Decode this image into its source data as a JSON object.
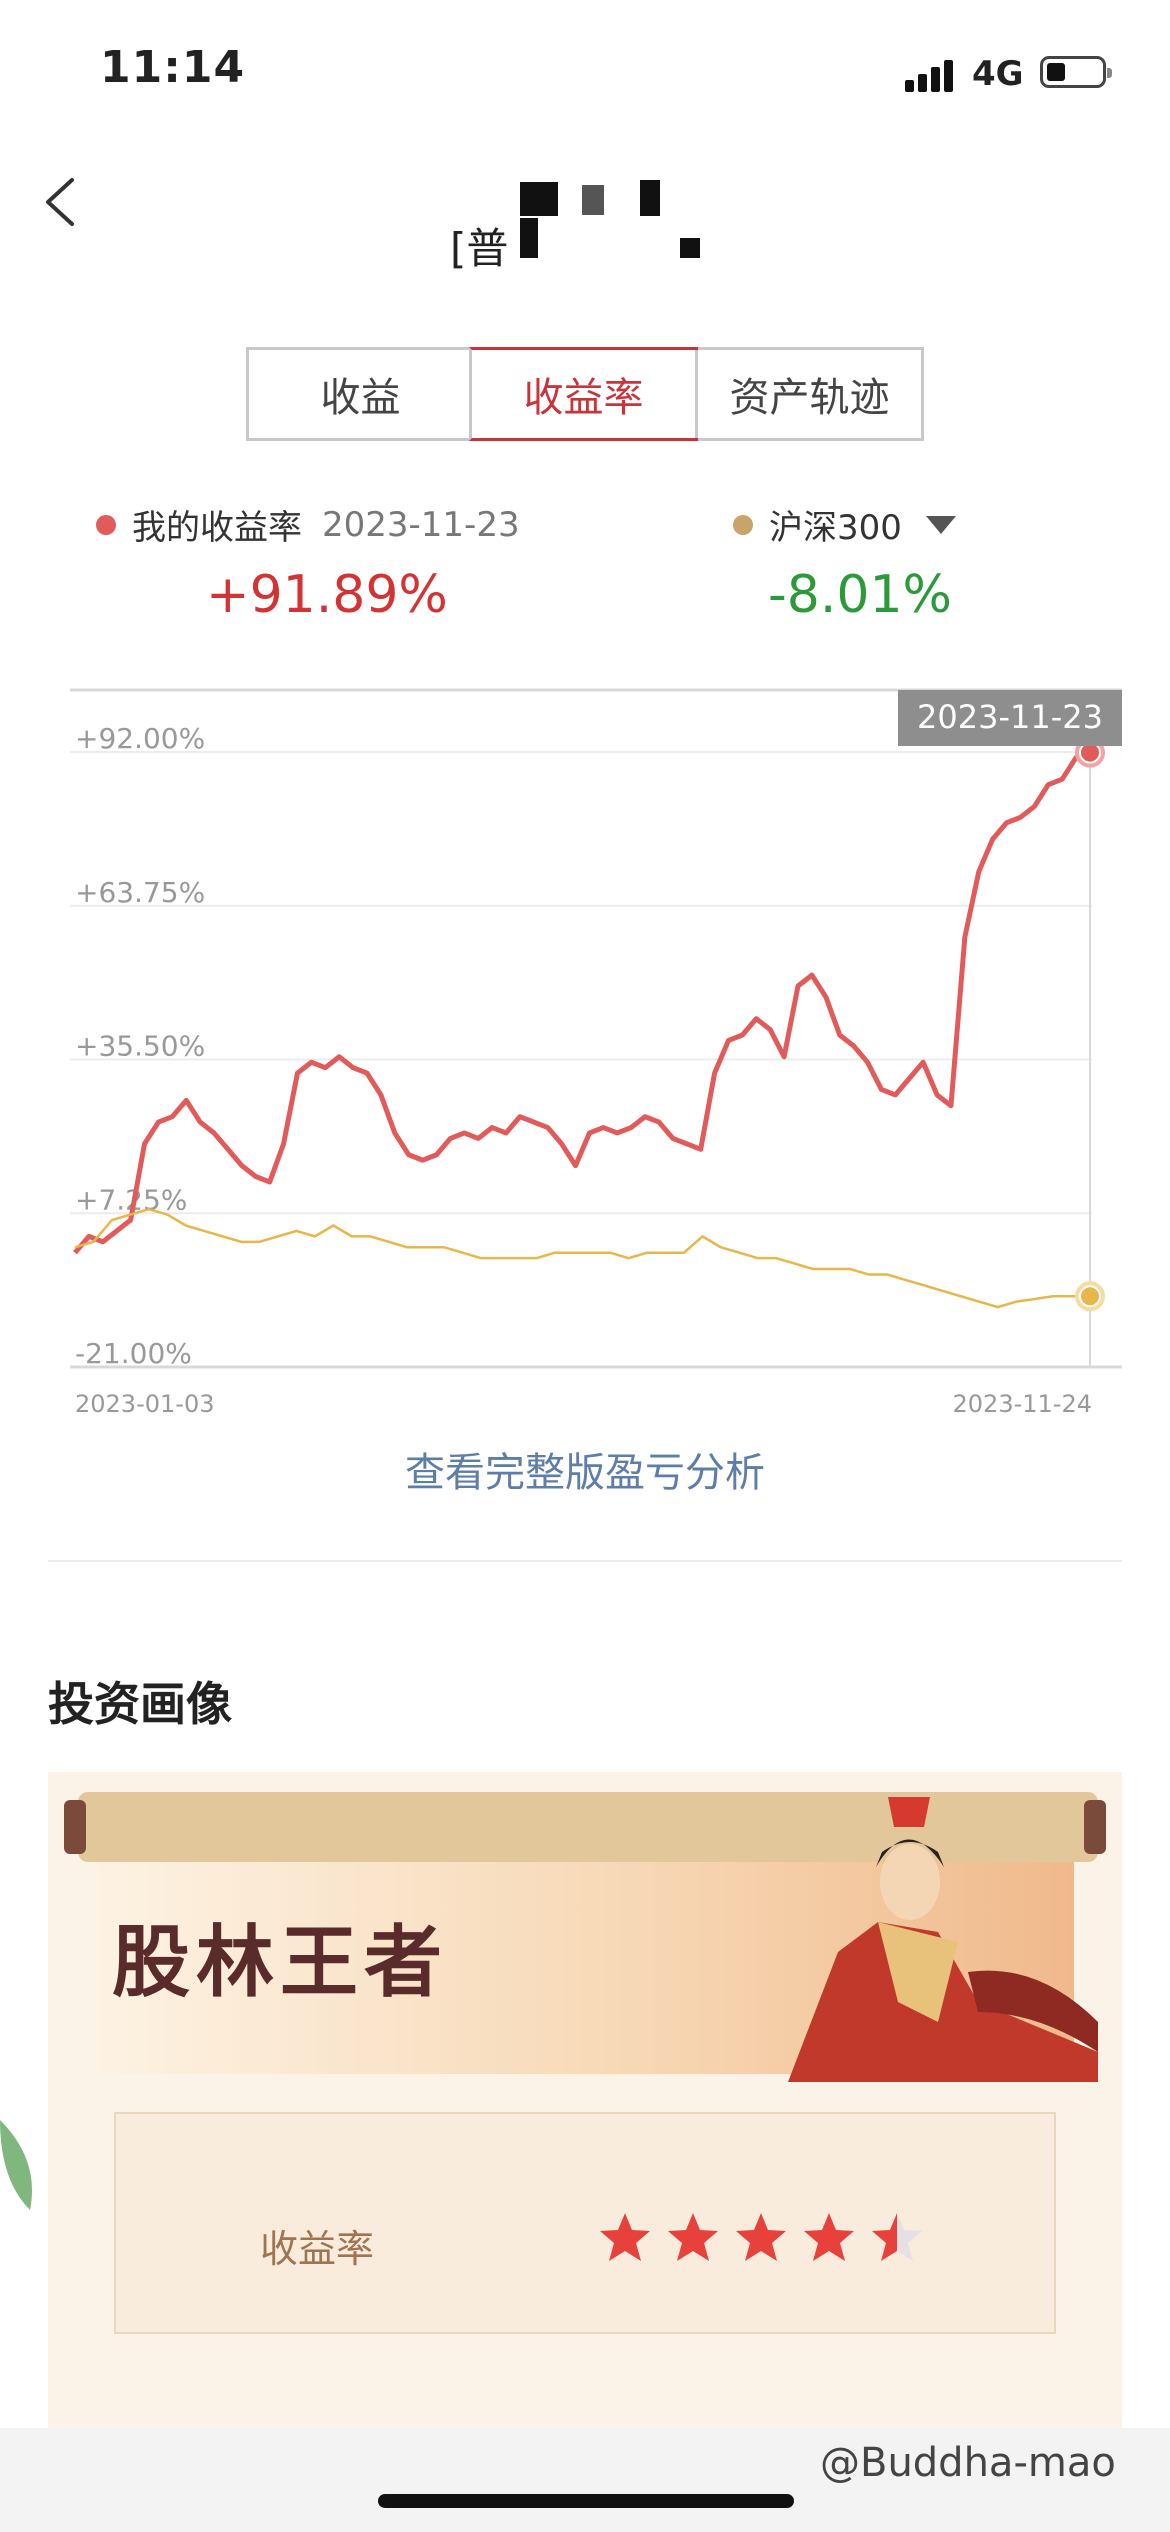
{
  "status_bar": {
    "time": "11:14",
    "network": "4G",
    "battery_level": 0.3
  },
  "header": {
    "title": "[普",
    "back_icon": "chevron-left-icon"
  },
  "tabs": [
    {
      "label": "收益",
      "active": false
    },
    {
      "label": "收益率",
      "active": true
    },
    {
      "label": "资产轨迹",
      "active": false
    }
  ],
  "legend": {
    "mine": {
      "label": "我的收益率",
      "date": "2023-11-23",
      "value": "+91.89%",
      "color": "#e25b5b"
    },
    "index": {
      "label": "沪深300",
      "value": "-8.01%",
      "color": "#c8a46a"
    }
  },
  "chart_data": {
    "type": "line",
    "y_tick_labels": [
      "+92.00%",
      "+63.75%",
      "+35.50%",
      "+7.25%",
      "-21.00%"
    ],
    "ylim": [
      -21.0,
      92.0
    ],
    "x_tick_labels": [
      "2023-01-03",
      "2023-11-24"
    ],
    "tooltip_date": "2023-11-23",
    "series": [
      {
        "name": "我的收益率",
        "color": "#e25b5b",
        "values": [
          0,
          3,
          2,
          4,
          6,
          20,
          24,
          25,
          28,
          24,
          22,
          19,
          16,
          14,
          13,
          20,
          33,
          35,
          34,
          36,
          34,
          33,
          29,
          22,
          18,
          17,
          18,
          21,
          22,
          21,
          23,
          22,
          25,
          24,
          23,
          20,
          16,
          22,
          23,
          22,
          23,
          25,
          24,
          21,
          20,
          19,
          33,
          39,
          40,
          43,
          41,
          36,
          49,
          51,
          47,
          40,
          38,
          35,
          30,
          29,
          32,
          35,
          29,
          27,
          58,
          70,
          76,
          79,
          80,
          82,
          86,
          87,
          91,
          91.89
        ]
      },
      {
        "name": "沪深300",
        "color": "#e8b64a",
        "values": [
          1,
          2,
          6,
          7,
          8,
          7,
          5,
          4,
          3,
          2,
          2,
          3,
          4,
          3,
          5,
          3,
          3,
          2,
          1,
          1,
          1,
          0,
          -1,
          -1,
          -1,
          -1,
          0,
          0,
          0,
          0,
          -1,
          0,
          0,
          0,
          3,
          1,
          0,
          -1,
          -1,
          -2,
          -3,
          -3,
          -3,
          -4,
          -4,
          -5,
          -6,
          -7,
          -8,
          -9,
          -10,
          -9,
          -8.5,
          -8,
          -8,
          -8.01
        ]
      }
    ],
    "grid": true
  },
  "link": {
    "label": "查看完整版盈亏分析"
  },
  "portrait": {
    "section_title": "投资画像",
    "banner_title": "股林王者",
    "metric_label": "收益率",
    "rating": 4.5,
    "rating_max": 5,
    "star_color": "#e8413c"
  },
  "watermark": "@Buddha-mao"
}
